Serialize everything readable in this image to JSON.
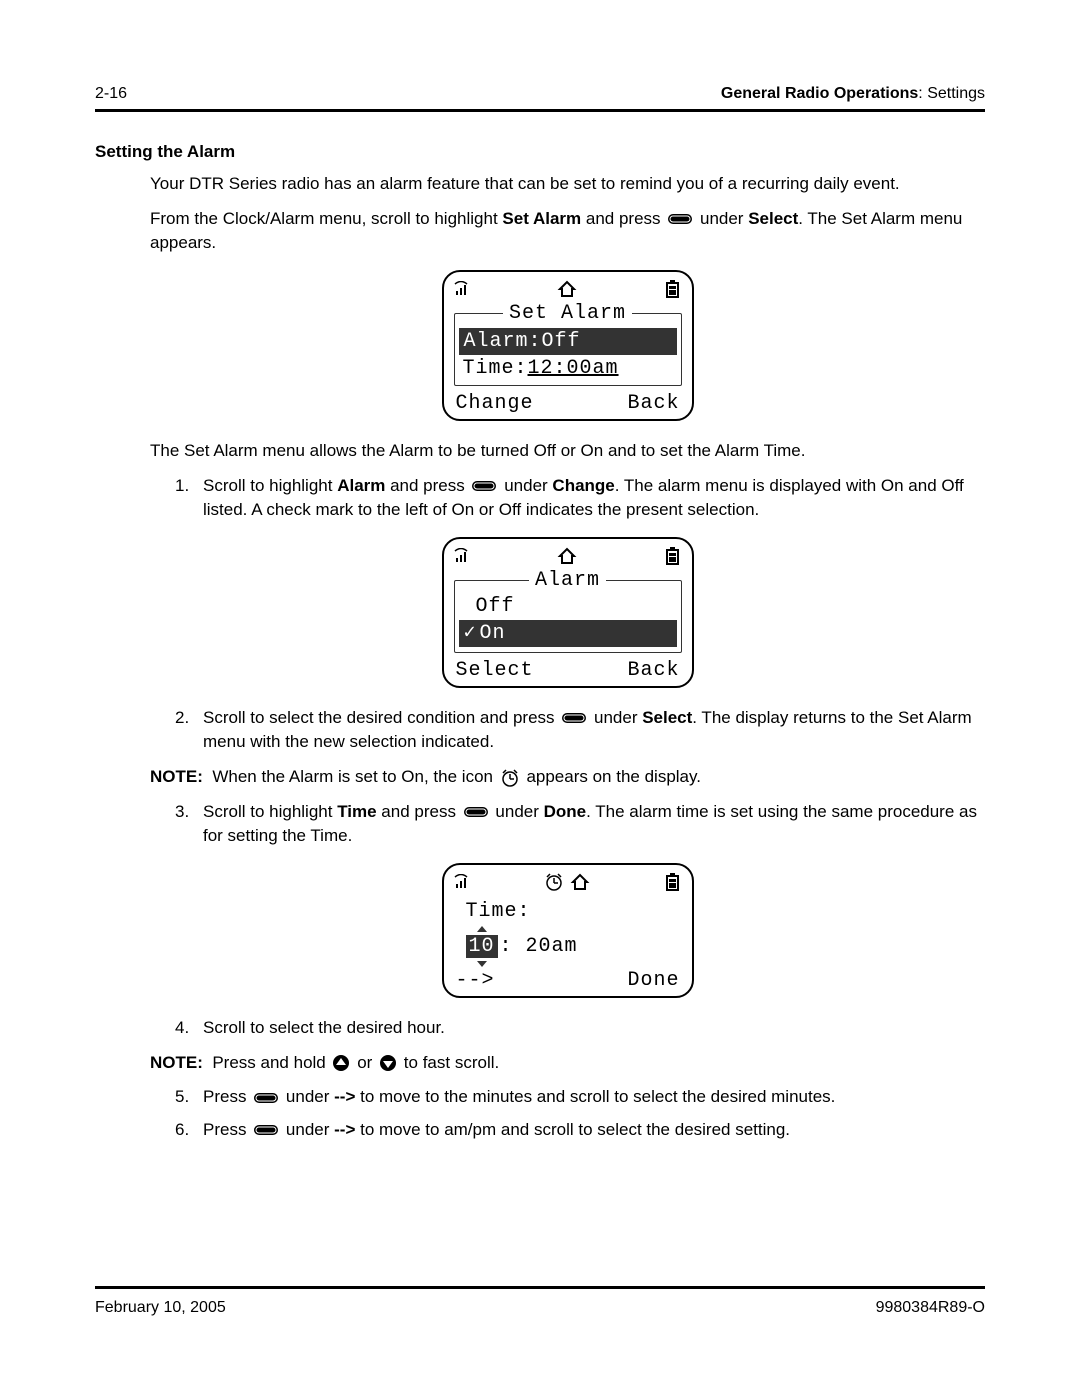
{
  "header": {
    "page_num": "2-16",
    "section_bold": "General Radio Operations",
    "section_rest": ": Settings"
  },
  "title": "Setting the Alarm",
  "intro": "Your DTR Series radio has an alarm feature that can be set to remind you of a recurring daily event.",
  "p2_a": "From the Clock/Alarm menu, scroll to highlight ",
  "p2_b": "Set Alarm",
  "p2_c": " and press ",
  "p2_d": " under ",
  "p2_e": "Select",
  "p2_f": ". The Set Alarm menu appears.",
  "lcd1": {
    "title": "Set Alarm",
    "row_sel": "Alarm:Off",
    "row2_a": "Time:",
    "row2_b": "12:00am",
    "soft_left": "Change",
    "soft_right": "Back"
  },
  "p3": "The Set Alarm menu allows the Alarm to be turned Off or On and to set the Alarm Time.",
  "step1_a": "Scroll to highlight ",
  "step1_b": "Alarm",
  "step1_c": " and press ",
  "step1_d": " under ",
  "step1_e": "Change",
  "step1_f": ". The alarm menu is displayed with On and Off listed. A check mark to the left of On or Off indicates the present selection.",
  "lcd2": {
    "title": "Alarm",
    "row1": "Off",
    "row_sel": "On",
    "soft_left": "Select",
    "soft_right": "Back"
  },
  "step2_a": "Scroll to select the desired condition and press ",
  "step2_b": " under ",
  "step2_c": "Select",
  "step2_d": ". The display returns to the Set Alarm menu with the new selection indicated.",
  "note1_a": "When the Alarm is set to On, the icon ",
  "note1_b": " appears on the display.",
  "step3_a": "Scroll to highlight ",
  "step3_b": "Time",
  "step3_c": " and press ",
  "step3_d": " under ",
  "step3_e": "Done",
  "step3_f": ". The alarm time is set using the same procedure as for setting the Time.",
  "lcd3": {
    "label": "Time:",
    "hour": "10",
    "rest": ":  20am",
    "soft_left": "-->",
    "soft_right": "Done"
  },
  "step4": "Scroll to select the desired hour.",
  "note2_a": "Press and hold ",
  "note2_b": " or ",
  "note2_c": " to fast scroll.",
  "step5_a": "Press ",
  "step5_b": " under ",
  "step5_c": "-->",
  "step5_d": " to move to the minutes and scroll to select the desired minutes.",
  "step6_a": "Press ",
  "step6_b": " under ",
  "step6_c": "-->",
  "step6_d": " to move to am/pm and scroll to select the desired setting.",
  "footer": {
    "date": "February 10, 2005",
    "doc": "9980384R89-O"
  },
  "labels": {
    "note": "NOTE:",
    "n1": "1.",
    "n2": "2.",
    "n3": "3.",
    "n4": "4.",
    "n5": "5.",
    "n6": "6."
  }
}
